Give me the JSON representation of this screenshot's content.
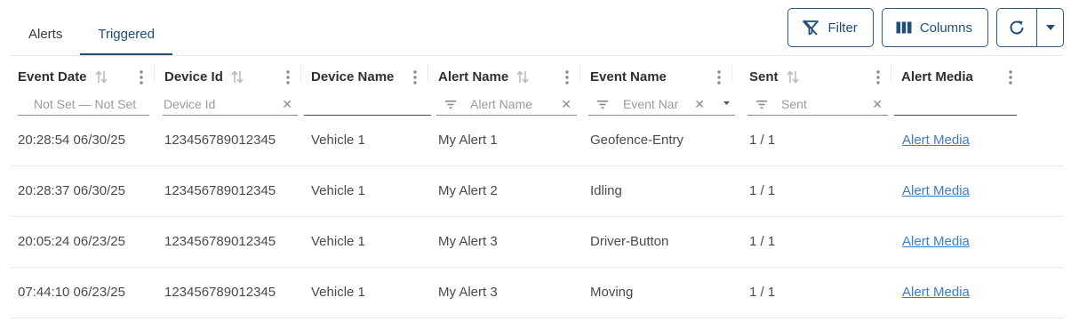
{
  "tabs": [
    {
      "label": "Alerts",
      "active": false
    },
    {
      "label": "Triggered",
      "active": true
    }
  ],
  "toolbar": {
    "filter_label": "Filter",
    "columns_label": "Columns",
    "accent_color": "#1f4f7a"
  },
  "columns": [
    {
      "label": "Event Date",
      "sortable": true,
      "filter_placeholder": "Not Set — Not Set"
    },
    {
      "label": "Device Id",
      "sortable": true,
      "filter_placeholder": "Device Id"
    },
    {
      "label": "Device Name",
      "sortable": false,
      "filter_placeholder": ""
    },
    {
      "label": "Alert Name",
      "sortable": true,
      "filter_placeholder": "Alert Name"
    },
    {
      "label": "Event Name",
      "sortable": false,
      "filter_placeholder": "Event Nar"
    },
    {
      "label": "Sent",
      "sortable": true,
      "filter_placeholder": "Sent"
    },
    {
      "label": "Alert Media",
      "sortable": false,
      "filter_placeholder": ""
    }
  ],
  "rows": [
    {
      "event_date": "20:28:54 06/30/25",
      "device_id": "123456789012345",
      "device_name": "Vehicle 1",
      "alert_name": "My Alert 1",
      "event_name": "Geofence-Entry",
      "sent": "1 / 1",
      "media": "Alert Media"
    },
    {
      "event_date": "20:28:37 06/30/25",
      "device_id": "123456789012345",
      "device_name": "Vehicle 1",
      "alert_name": "My Alert 2",
      "event_name": "Idling",
      "sent": "1 / 1",
      "media": "Alert Media"
    },
    {
      "event_date": "20:05:24 06/23/25",
      "device_id": "123456789012345",
      "device_name": "Vehicle 1",
      "alert_name": "My Alert 3",
      "event_name": "Driver-Button",
      "sent": "1 / 1",
      "media": "Alert Media"
    },
    {
      "event_date": "07:44:10 06/23/25",
      "device_id": "123456789012345",
      "device_name": "Vehicle 1",
      "alert_name": "My Alert 3",
      "event_name": "Moving",
      "sent": "1 / 1",
      "media": "Alert Media"
    }
  ]
}
